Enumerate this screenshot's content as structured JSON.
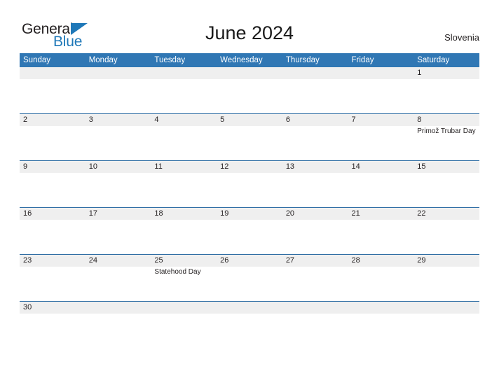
{
  "brand": {
    "name_part1": "General",
    "name_part2": "Blue",
    "flag_icon": "blue-triangle-flag-icon"
  },
  "header": {
    "title": "June 2024",
    "region": "Slovenia"
  },
  "colors": {
    "header_blue": "#3077B4",
    "row_rule_blue": "#2E6DA4",
    "daynum_band": "#EFEFEF",
    "brand_blue": "#1F78B8",
    "text": "#231F20"
  },
  "calendar": {
    "month": "June",
    "year": "2024",
    "weekday_headers": [
      "Sunday",
      "Monday",
      "Tuesday",
      "Wednesday",
      "Thursday",
      "Friday",
      "Saturday"
    ],
    "weeks": [
      {
        "days": [
          {
            "num": "",
            "event": ""
          },
          {
            "num": "",
            "event": ""
          },
          {
            "num": "",
            "event": ""
          },
          {
            "num": "",
            "event": ""
          },
          {
            "num": "",
            "event": ""
          },
          {
            "num": "",
            "event": ""
          },
          {
            "num": "1",
            "event": ""
          }
        ]
      },
      {
        "days": [
          {
            "num": "2",
            "event": ""
          },
          {
            "num": "3",
            "event": ""
          },
          {
            "num": "4",
            "event": ""
          },
          {
            "num": "5",
            "event": ""
          },
          {
            "num": "6",
            "event": ""
          },
          {
            "num": "7",
            "event": ""
          },
          {
            "num": "8",
            "event": "Primož Trubar Day"
          }
        ]
      },
      {
        "days": [
          {
            "num": "9",
            "event": ""
          },
          {
            "num": "10",
            "event": ""
          },
          {
            "num": "11",
            "event": ""
          },
          {
            "num": "12",
            "event": ""
          },
          {
            "num": "13",
            "event": ""
          },
          {
            "num": "14",
            "event": ""
          },
          {
            "num": "15",
            "event": ""
          }
        ]
      },
      {
        "days": [
          {
            "num": "16",
            "event": ""
          },
          {
            "num": "17",
            "event": ""
          },
          {
            "num": "18",
            "event": ""
          },
          {
            "num": "19",
            "event": ""
          },
          {
            "num": "20",
            "event": ""
          },
          {
            "num": "21",
            "event": ""
          },
          {
            "num": "22",
            "event": ""
          }
        ]
      },
      {
        "days": [
          {
            "num": "23",
            "event": ""
          },
          {
            "num": "24",
            "event": ""
          },
          {
            "num": "25",
            "event": "Statehood Day"
          },
          {
            "num": "26",
            "event": ""
          },
          {
            "num": "27",
            "event": ""
          },
          {
            "num": "28",
            "event": ""
          },
          {
            "num": "29",
            "event": ""
          }
        ]
      },
      {
        "days": [
          {
            "num": "30",
            "event": ""
          },
          {
            "num": "",
            "event": ""
          },
          {
            "num": "",
            "event": ""
          },
          {
            "num": "",
            "event": ""
          },
          {
            "num": "",
            "event": ""
          },
          {
            "num": "",
            "event": ""
          },
          {
            "num": "",
            "event": ""
          }
        ]
      }
    ]
  }
}
